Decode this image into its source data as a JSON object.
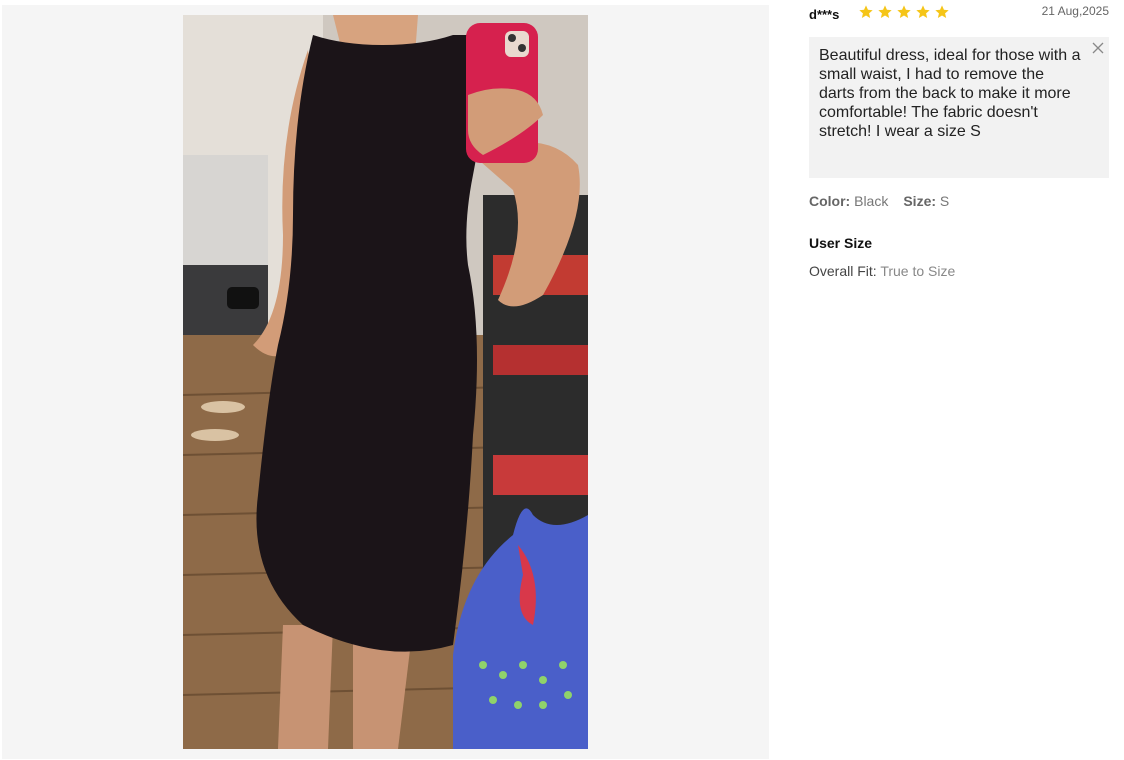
{
  "review": {
    "username": "d***s",
    "rating": 5,
    "rating_max": 5,
    "star_color": "#f5c518",
    "date": "21 Aug,2025",
    "comment": "Beautiful dress, ideal for those with a small waist, I had to remove the darts from the back to make it more comfortable! The fabric doesn't stretch! I wear a size S",
    "close_icon": "close-icon",
    "attributes": [
      {
        "key": "Color:",
        "value": "Black"
      },
      {
        "key": "Size:",
        "value": "S"
      }
    ],
    "user_size": {
      "title": "User Size",
      "fit_label": "Overall Fit:",
      "fit_value": "True to Size"
    }
  }
}
